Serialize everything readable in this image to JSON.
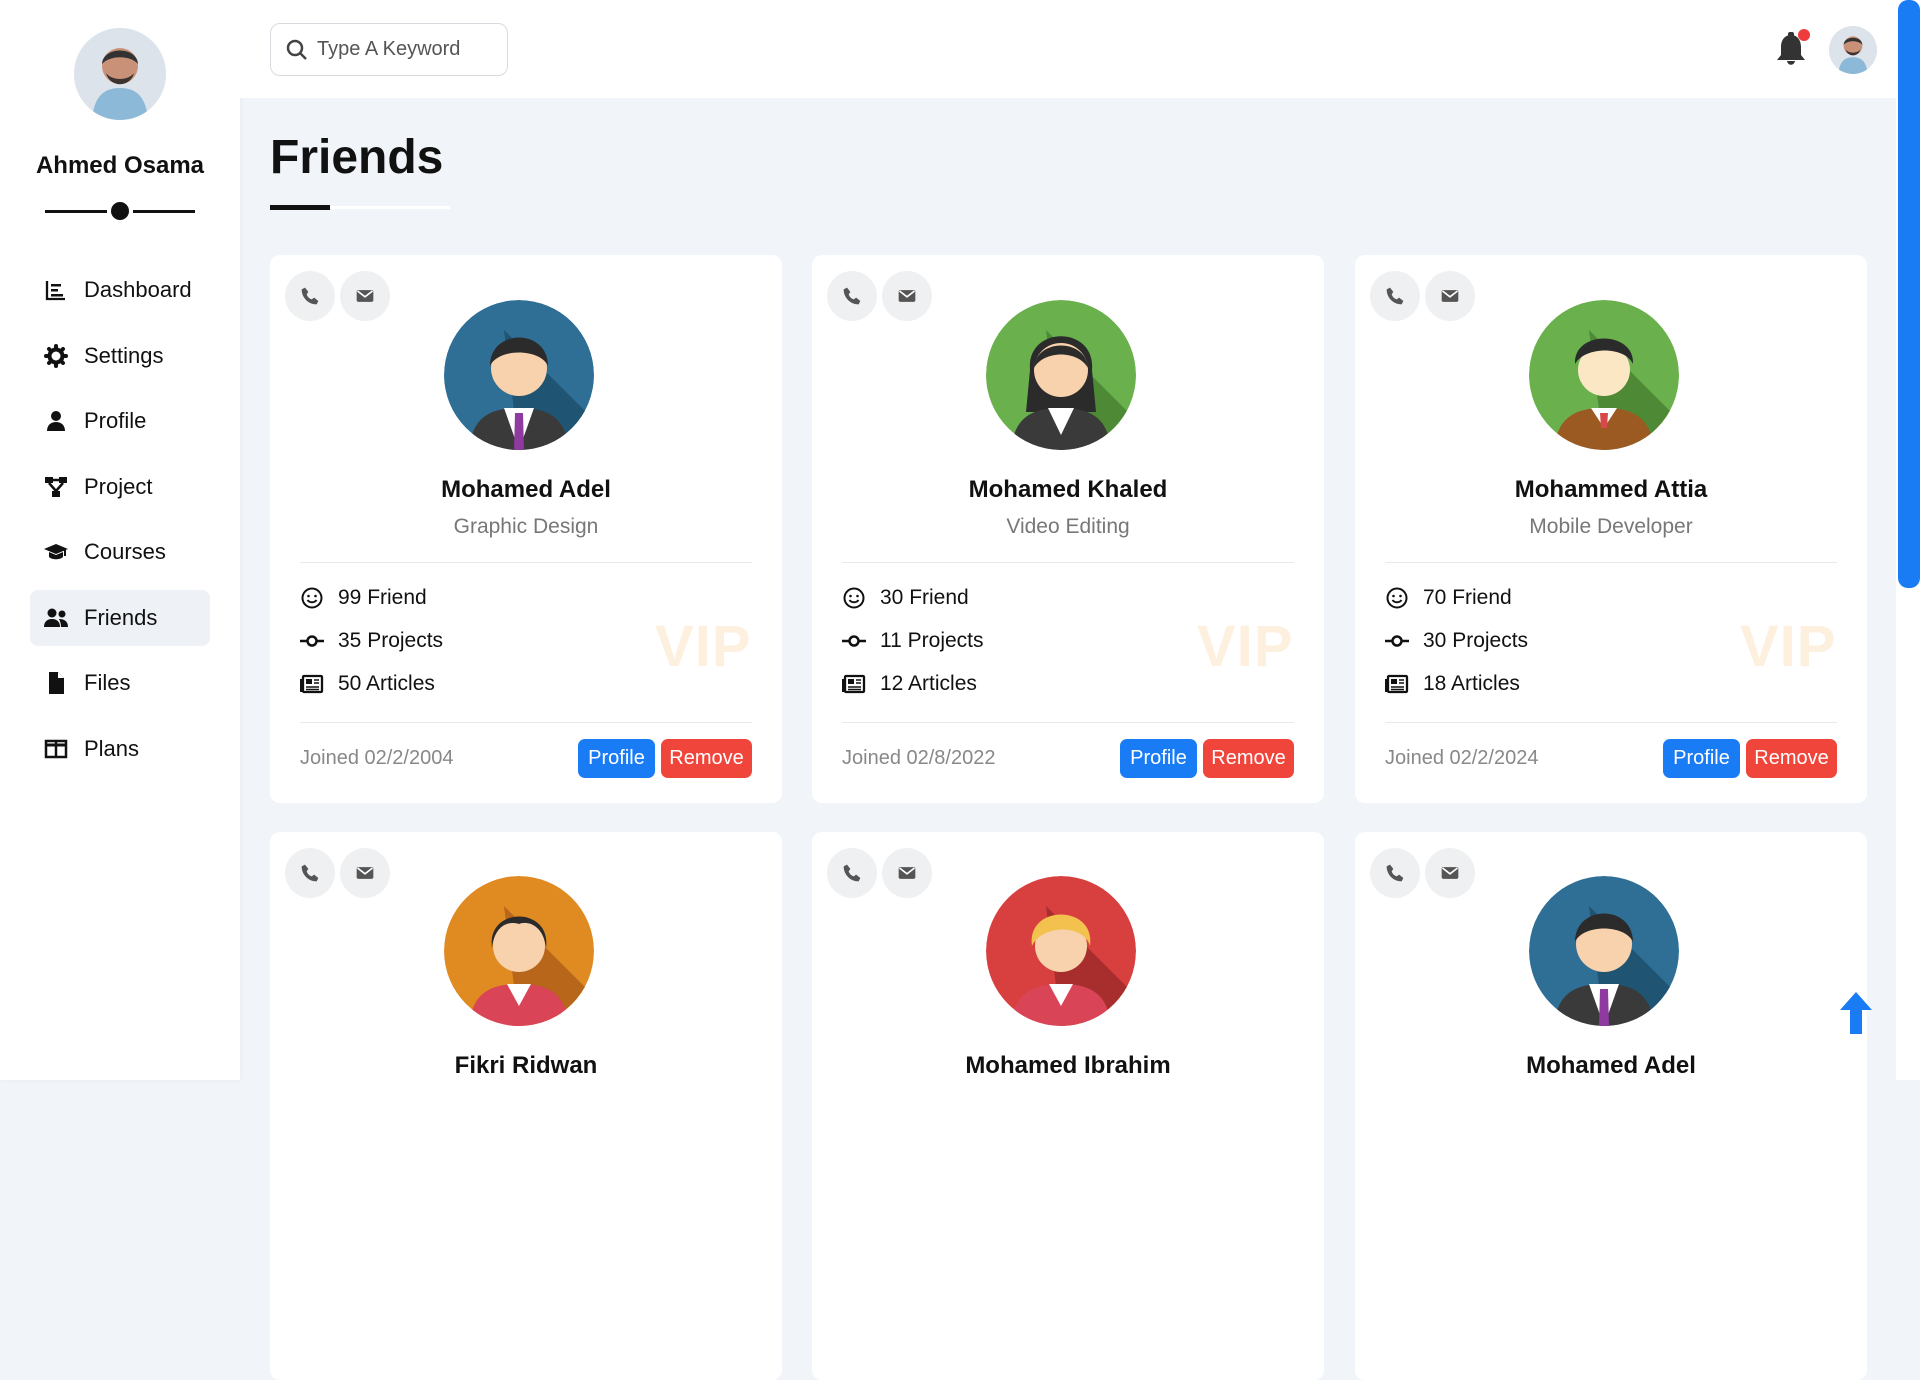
{
  "user": {
    "name": "Ahmed Osama"
  },
  "nav": [
    {
      "label": "Dashboard",
      "icon": "chart-icon"
    },
    {
      "label": "Settings",
      "icon": "gear-icon"
    },
    {
      "label": "Profile",
      "icon": "user-icon"
    },
    {
      "label": "Project",
      "icon": "diagram-icon"
    },
    {
      "label": "Courses",
      "icon": "graduation-cap-icon"
    },
    {
      "label": "Friends",
      "icon": "users-icon",
      "active": true
    },
    {
      "label": "Files",
      "icon": "file-icon"
    },
    {
      "label": "Plans",
      "icon": "columns-icon"
    }
  ],
  "search": {
    "placeholder": "Type A Keyword"
  },
  "page": {
    "title": "Friends"
  },
  "friends": [
    {
      "name": "Mohamed Adel",
      "job": "Graphic Design",
      "friends": "99 Friend",
      "projects": "35 Projects",
      "articles": "50 Articles",
      "badge": "VIP",
      "joined": "Joined 02/2/2004",
      "profile_label": "Profile",
      "remove_label": "Remove",
      "avatar_color": "#2f6f96",
      "avatar": "man-suit-avatar"
    },
    {
      "name": "Mohamed Khaled",
      "job": "Video Editing",
      "friends": "30 Friend",
      "projects": "11 Projects",
      "articles": "12 Articles",
      "badge": "VIP",
      "joined": "Joined 02/8/2022",
      "profile_label": "Profile",
      "remove_label": "Remove",
      "avatar_color": "#6ab04c",
      "avatar": "woman-avatar"
    },
    {
      "name": "Mohammed Attia",
      "job": "Mobile Developer",
      "friends": "70 Friend",
      "projects": "30 Projects",
      "articles": "18 Articles",
      "badge": "VIP",
      "joined": "Joined 02/2/2024",
      "profile_label": "Profile",
      "remove_label": "Remove",
      "avatar_color": "#6ab04c",
      "avatar": "man-sweater-avatar"
    },
    {
      "name": "Fikri Ridwan",
      "avatar_color": "#e08a22",
      "avatar": "woman-red-avatar"
    },
    {
      "name": "Mohamed Ibrahim",
      "avatar_color": "#d84040",
      "avatar": "blonde-woman-avatar"
    },
    {
      "name": "Mohamed Adel",
      "avatar_color": "#2f6f96",
      "avatar": "man-suit-avatar"
    }
  ],
  "colors": {
    "primary": "#1a7cf5",
    "danger": "#f0453b",
    "notification": "#ef3b3b",
    "vip": "#fdf0de"
  }
}
